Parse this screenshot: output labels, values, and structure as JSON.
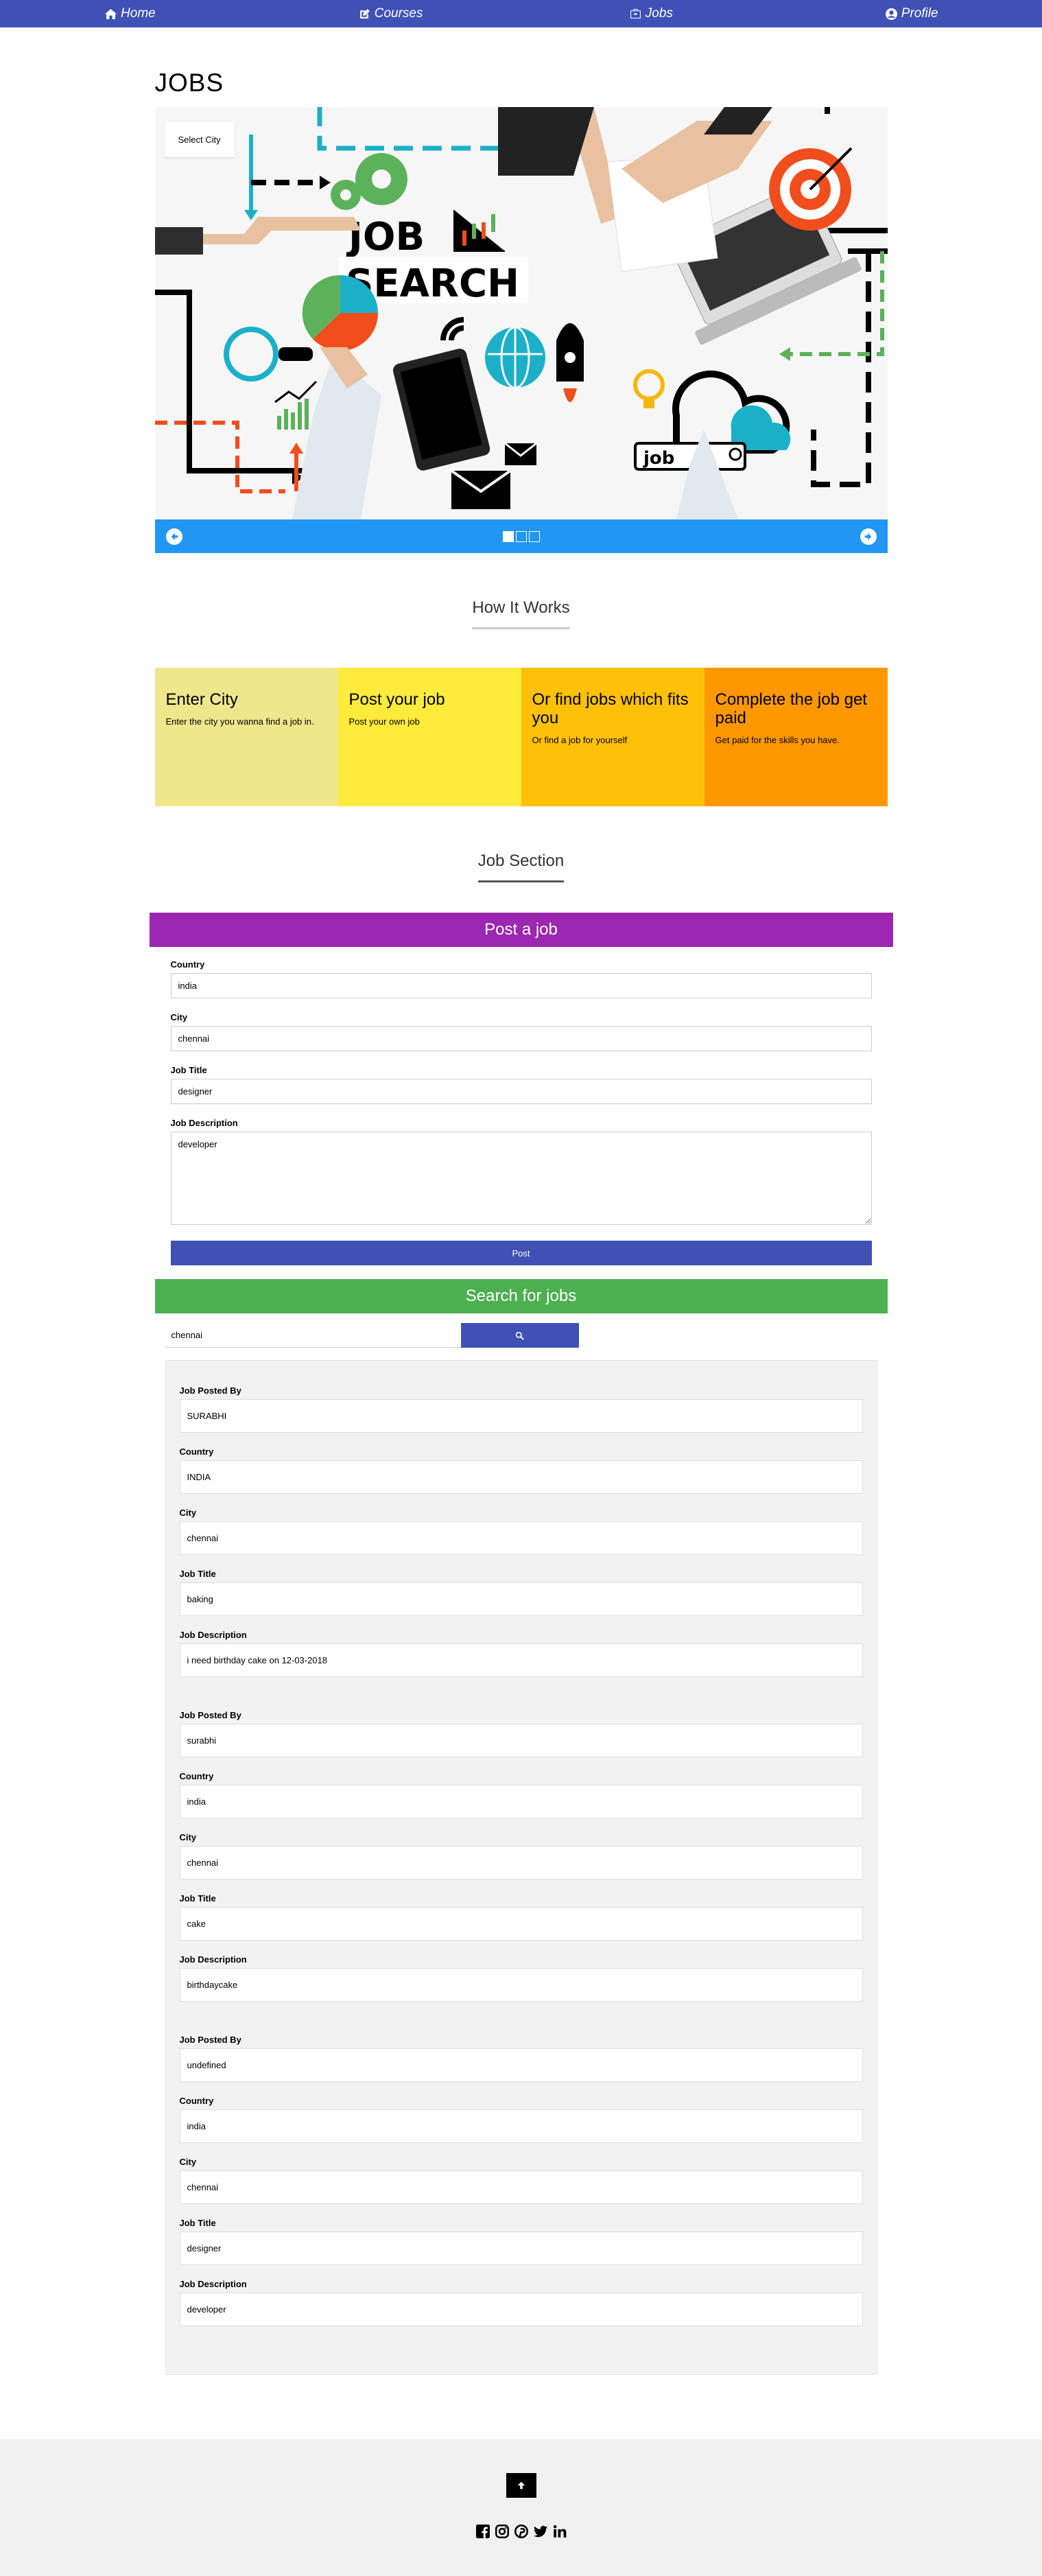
{
  "nav": {
    "items": [
      {
        "label": "Home",
        "icon": "home-icon"
      },
      {
        "label": "Courses",
        "icon": "edit-icon"
      },
      {
        "label": "Jobs",
        "icon": "briefcase-icon"
      },
      {
        "label": "Profile",
        "icon": "user-circle-icon"
      }
    ]
  },
  "page_title": "JOBS",
  "hero": {
    "select_city": "Select City",
    "headline_line1": "JOB",
    "headline_line2": "SEARCH",
    "search_box_text": "job",
    "slides": 3,
    "active_slide": 1
  },
  "how_it_works": {
    "title": "How It Works",
    "steps": [
      {
        "title": "Enter City",
        "text": "Enter the city you wanna find a job in.",
        "color": "#f0e68c"
      },
      {
        "title": "Post your job",
        "text": "Post your own job",
        "color": "#ffeb3b"
      },
      {
        "title": "Or find jobs which fits you",
        "text": "Or find a job for yourself",
        "color": "#ffc107"
      },
      {
        "title": "Complete the job get paid",
        "text": "Get paid for the skills you have.",
        "color": "#ff9800"
      }
    ]
  },
  "job_section": {
    "title": "Job Section",
    "post": {
      "header": "Post a job",
      "country_label": "Country",
      "country_value": "india",
      "city_label": "City",
      "city_value": "chennai",
      "title_label": "Job Title",
      "title_value": "designer",
      "description_label": "Job Description",
      "description_value": "developer",
      "button": "Post"
    },
    "search": {
      "header": "Search for jobs",
      "query": "chennai"
    }
  },
  "results_labels": {
    "posted_by": "Job Posted By",
    "country": "Country",
    "city": "City",
    "title": "Job Title",
    "description": "Job Description"
  },
  "results": [
    {
      "posted_by": "SURABHI",
      "country": "INDIA",
      "city": "chennai",
      "title": "baking",
      "description": "i need birthday cake on 12-03-2018"
    },
    {
      "posted_by": "surabhi",
      "country": "india",
      "city": "chennai",
      "title": "cake",
      "description": "birthdaycake"
    },
    {
      "posted_by": "undefined",
      "country": "india",
      "city": "chennai",
      "title": "designer",
      "description": "developer"
    }
  ],
  "colors": {
    "nav": "#3f51b5",
    "slider": "#2196f3",
    "post_header": "#9c27b0",
    "search_header": "#4caf50",
    "button": "#3f51b5"
  },
  "footer": {
    "social": [
      "facebook-icon",
      "instagram-icon",
      "pinterest-icon",
      "twitter-icon",
      "linkedin-icon"
    ]
  }
}
